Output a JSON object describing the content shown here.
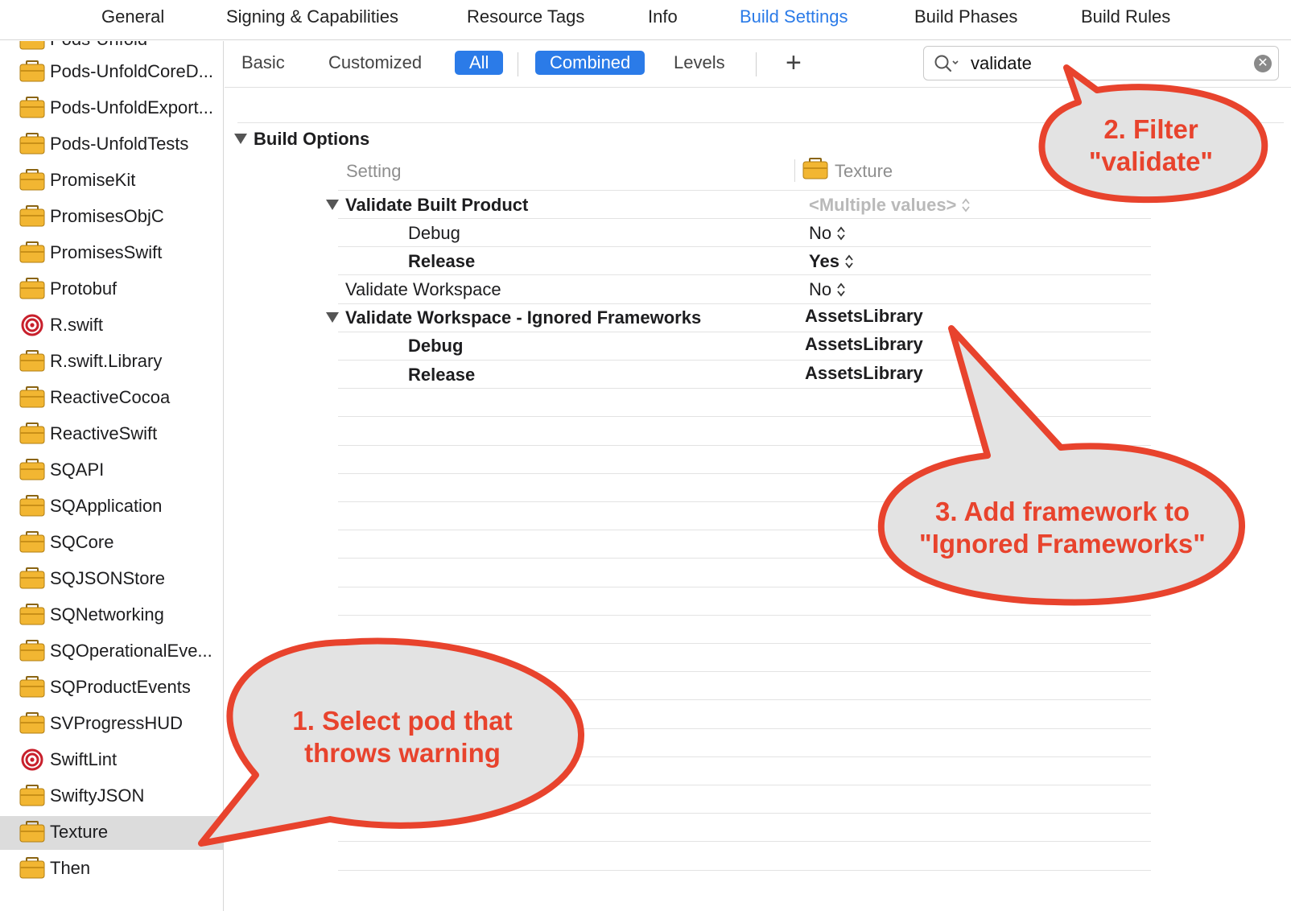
{
  "top_tabs": [
    "General",
    "Signing & Capabilities",
    "Resource Tags",
    "Info",
    "Build Settings",
    "Build Phases",
    "Build Rules"
  ],
  "active_top_tab": "Build Settings",
  "sidebar": {
    "partial_item": "Pods-Unfold",
    "items": [
      {
        "label": "Pods-UnfoldCoreD...",
        "icon": "target-folder-icon"
      },
      {
        "label": "Pods-UnfoldExport...",
        "icon": "target-folder-icon"
      },
      {
        "label": "Pods-UnfoldTests",
        "icon": "target-folder-icon"
      },
      {
        "label": "PromiseKit",
        "icon": "target-folder-icon"
      },
      {
        "label": "PromisesObjC",
        "icon": "target-folder-icon"
      },
      {
        "label": "PromisesSwift",
        "icon": "target-folder-icon"
      },
      {
        "label": "Protobuf",
        "icon": "target-folder-icon"
      },
      {
        "label": "R.swift",
        "icon": "bullseye-target-icon"
      },
      {
        "label": "R.swift.Library",
        "icon": "target-folder-icon"
      },
      {
        "label": "ReactiveCocoa",
        "icon": "target-folder-icon"
      },
      {
        "label": "ReactiveSwift",
        "icon": "target-folder-icon"
      },
      {
        "label": "SQAPI",
        "icon": "target-folder-icon"
      },
      {
        "label": "SQApplication",
        "icon": "target-folder-icon"
      },
      {
        "label": "SQCore",
        "icon": "target-folder-icon"
      },
      {
        "label": "SQJSONStore",
        "icon": "target-folder-icon"
      },
      {
        "label": "SQNetworking",
        "icon": "target-folder-icon"
      },
      {
        "label": "SQOperationalEve...",
        "icon": "target-folder-icon"
      },
      {
        "label": "SQProductEvents",
        "icon": "target-folder-icon"
      },
      {
        "label": "SVProgressHUD",
        "icon": "target-folder-icon"
      },
      {
        "label": "SwiftLint",
        "icon": "bullseye-target-icon"
      },
      {
        "label": "SwiftyJSON",
        "icon": "target-folder-icon"
      },
      {
        "label": "Texture",
        "icon": "target-folder-icon",
        "selected": true
      },
      {
        "label": "Then",
        "icon": "target-folder-icon"
      }
    ]
  },
  "filter": {
    "basic": "Basic",
    "customized": "Customized",
    "all": "All",
    "combined": "Combined",
    "levels": "Levels",
    "add": "+",
    "search_value": "validate"
  },
  "settings": {
    "section": "Build Options",
    "col_setting": "Setting",
    "col_target": "Texture",
    "rows": {
      "vbp_name": "Validate Built Product",
      "vbp_value": "<Multiple values>",
      "vbp_debug": "Debug",
      "vbp_debug_value": "No",
      "vbp_release": "Release",
      "vbp_release_value": "Yes",
      "vw_name": "Validate Workspace",
      "vw_value": "No",
      "vwif_name": "Validate Workspace - Ignored Frameworks",
      "vwif_value": "AssetsLibrary",
      "vwif_debug": "Debug",
      "vwif_debug_value": "AssetsLibrary",
      "vwif_release": "Release",
      "vwif_release_value": "AssetsLibrary"
    }
  },
  "callouts": {
    "c1_line1": "1. Select pod that",
    "c1_line2": "throws warning",
    "c2_line1": "2. Filter",
    "c2_line2": "\"validate\"",
    "c3_line1": "3. Add framework to",
    "c3_line2": "\"Ignored Frameworks\""
  },
  "colors": {
    "accent": "#2b7be8",
    "callout_stroke": "#e8432d",
    "callout_fill": "#e3e3e3"
  }
}
